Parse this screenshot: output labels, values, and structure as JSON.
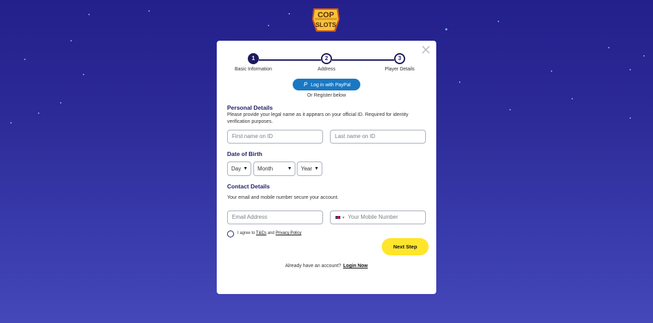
{
  "brand": {
    "logo_line1": "COP",
    "logo_line2": "SLOTS"
  },
  "steps": [
    {
      "number": "1",
      "label": "Basic Information"
    },
    {
      "number": "2",
      "label": "Address"
    },
    {
      "number": "3",
      "label": "Player Details"
    }
  ],
  "paypal_button": {
    "icon": "P",
    "label": "Log in with PayPal"
  },
  "or_register": "Or Register below",
  "personal": {
    "title": "Personal Details",
    "description": "Please provide your legal name as it appears on your official ID. Required for identity verification purposes.",
    "first_name_placeholder": "First name on ID",
    "last_name_placeholder": "Last name on ID"
  },
  "dob": {
    "title": "Date of Birth",
    "day": "Day",
    "month": "Month",
    "year": "Year"
  },
  "contact": {
    "title": "Contact Details",
    "description": "Your email and mobile number secure your account.",
    "email_placeholder": "Email Address",
    "country_code_caret": "▾",
    "phone_placeholder": "Your Mobile Number"
  },
  "agreement": {
    "prefix": "I agree to",
    "tcs": "T&Cs",
    "and": "and",
    "privacy": "Privacy Policy"
  },
  "next_button": "Next Step",
  "already": {
    "text": "Already have an account?",
    "login": "Login Now"
  },
  "colors": {
    "background": "#2c2a96",
    "accent_yellow": "#ffe52c",
    "paypal_blue": "#1a78c2",
    "navy": "#1d1a5e"
  },
  "icons": {
    "close": "close-icon",
    "paypal": "paypal-icon",
    "flag": "uk-flag-icon",
    "chevron": "chevron-down-icon"
  }
}
